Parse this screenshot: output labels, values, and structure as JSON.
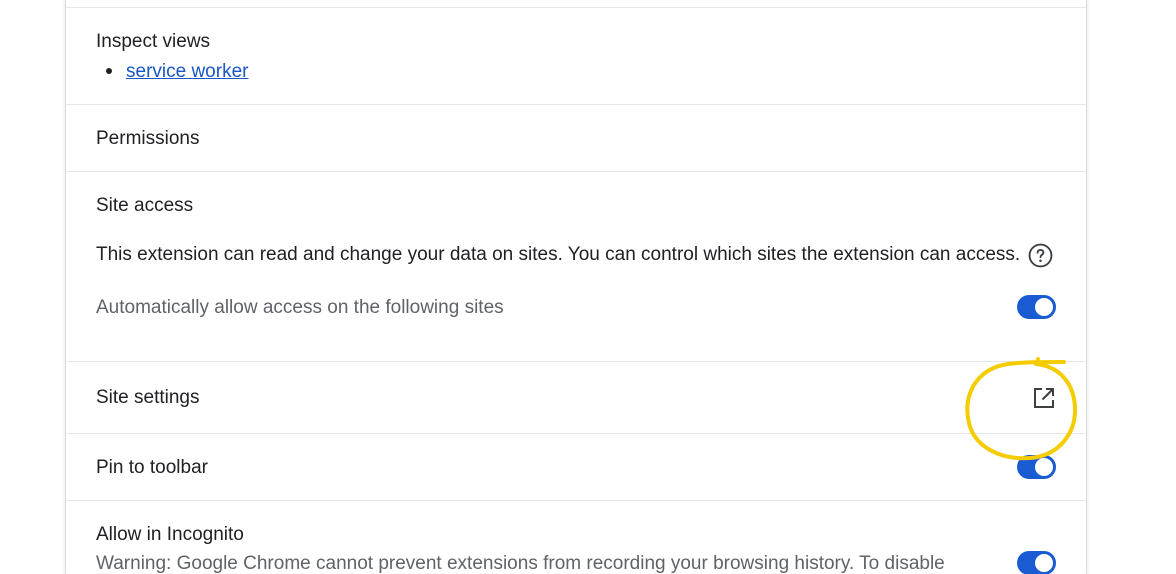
{
  "inspect_views": {
    "title": "Inspect views",
    "link_label": "service worker"
  },
  "permissions": {
    "title": "Permissions"
  },
  "site_access": {
    "title": "Site access",
    "description": "This extension can read and change your data on sites. You can control which sites the extension can access.",
    "auto_allow_label": "Automatically allow access on the following sites",
    "auto_allow_enabled": true
  },
  "site_settings": {
    "label": "Site settings",
    "icon": "open-in-new-icon"
  },
  "pin_to_toolbar": {
    "label": "Pin to toolbar",
    "enabled": true
  },
  "incognito": {
    "title": "Allow in Incognito",
    "warning": "Warning: Google Chrome cannot prevent extensions from recording your browsing history. To disable",
    "enabled": true
  },
  "colors": {
    "accent": "#1a5ad2",
    "link": "#1a56c6",
    "highlight_annotation": "#f5cc00"
  }
}
